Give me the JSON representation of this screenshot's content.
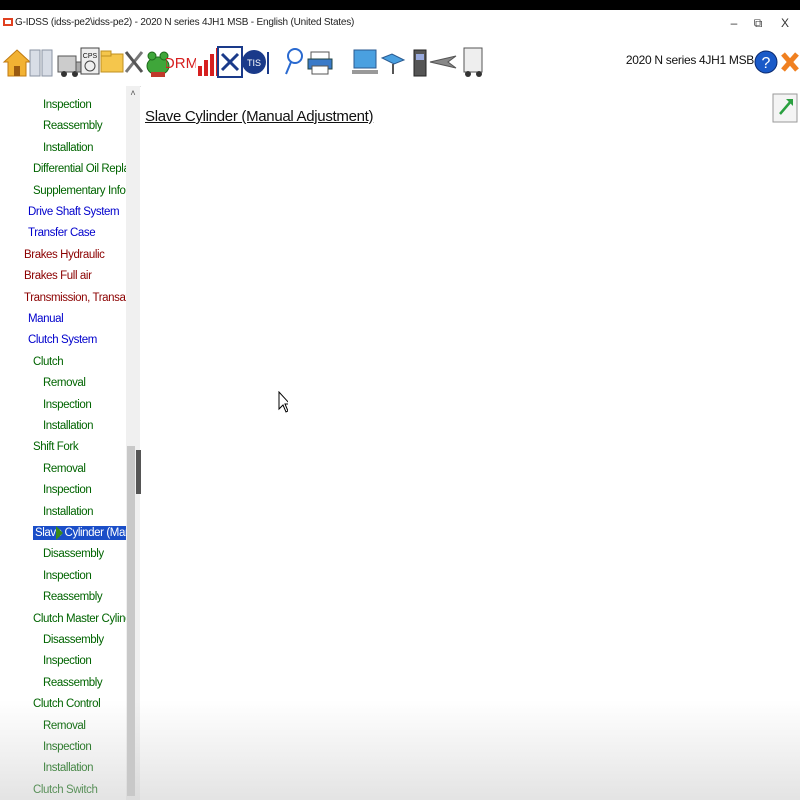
{
  "window": {
    "title": "G-IDSS (idss-pe2\\idss-pe2) - 2020 N series 4JH1 MSB - English (United States)",
    "minimize": "–",
    "restore": "⧉",
    "close": "X"
  },
  "toolbar": {
    "drm_label": "DRM",
    "tis_label": "TIS",
    "vehicle_label": "2020 N series 4JH1 MSB",
    "help_label": "?"
  },
  "nav": {
    "items": [
      {
        "label": "Inspection",
        "level": "g"
      },
      {
        "label": "Reassembly",
        "level": "g"
      },
      {
        "label": "Installation",
        "level": "g"
      },
      {
        "label": "Differential Oil Replacem",
        "level": "g"
      },
      {
        "label": "Supplementary Informati",
        "level": "g"
      },
      {
        "label": "Drive Shaft System",
        "level": "b"
      },
      {
        "label": "Transfer Case",
        "level": "b"
      },
      {
        "label": "Brakes Hydraulic",
        "level": "r"
      },
      {
        "label": "Brakes Full air",
        "level": "r"
      },
      {
        "label": "Transmission, Transaxle M",
        "level": "r"
      },
      {
        "label": "Manual",
        "level": "b"
      },
      {
        "label": "Clutch System",
        "level": "b"
      },
      {
        "label": "Clutch",
        "level": "g"
      },
      {
        "label": "Removal",
        "level": "g"
      },
      {
        "label": "Inspection",
        "level": "g"
      },
      {
        "label": "Installation",
        "level": "g"
      },
      {
        "label": "Shift Fork",
        "level": "g"
      },
      {
        "label": "Removal",
        "level": "g"
      },
      {
        "label": "Inspection",
        "level": "g"
      },
      {
        "label": "Installation",
        "level": "g"
      },
      {
        "label": "Slave Cylinder (Manual A",
        "level": "g"
      },
      {
        "label": "Disassembly",
        "level": "g"
      },
      {
        "label": "Inspection",
        "level": "g"
      },
      {
        "label": "Reassembly",
        "level": "g"
      },
      {
        "label": "Clutch Master Cylinder",
        "level": "g"
      },
      {
        "label": "Disassembly",
        "level": "g"
      },
      {
        "label": "Inspection",
        "level": "g"
      },
      {
        "label": "Reassembly",
        "level": "g"
      },
      {
        "label": "Clutch Control",
        "level": "g"
      },
      {
        "label": "Removal",
        "level": "g"
      },
      {
        "label": "Inspection",
        "level": "g"
      },
      {
        "label": "Installation",
        "level": "g"
      },
      {
        "label": "Clutch Switch",
        "level": "g"
      }
    ],
    "selected_index": 20
  },
  "main": {
    "doc_title": "Slave Cylinder (Manual Adjustment)"
  },
  "colors": {
    "nav_red": "#8b0000",
    "nav_blue": "#0000cc",
    "nav_green": "#006400",
    "selection": "#1a4ec8"
  }
}
